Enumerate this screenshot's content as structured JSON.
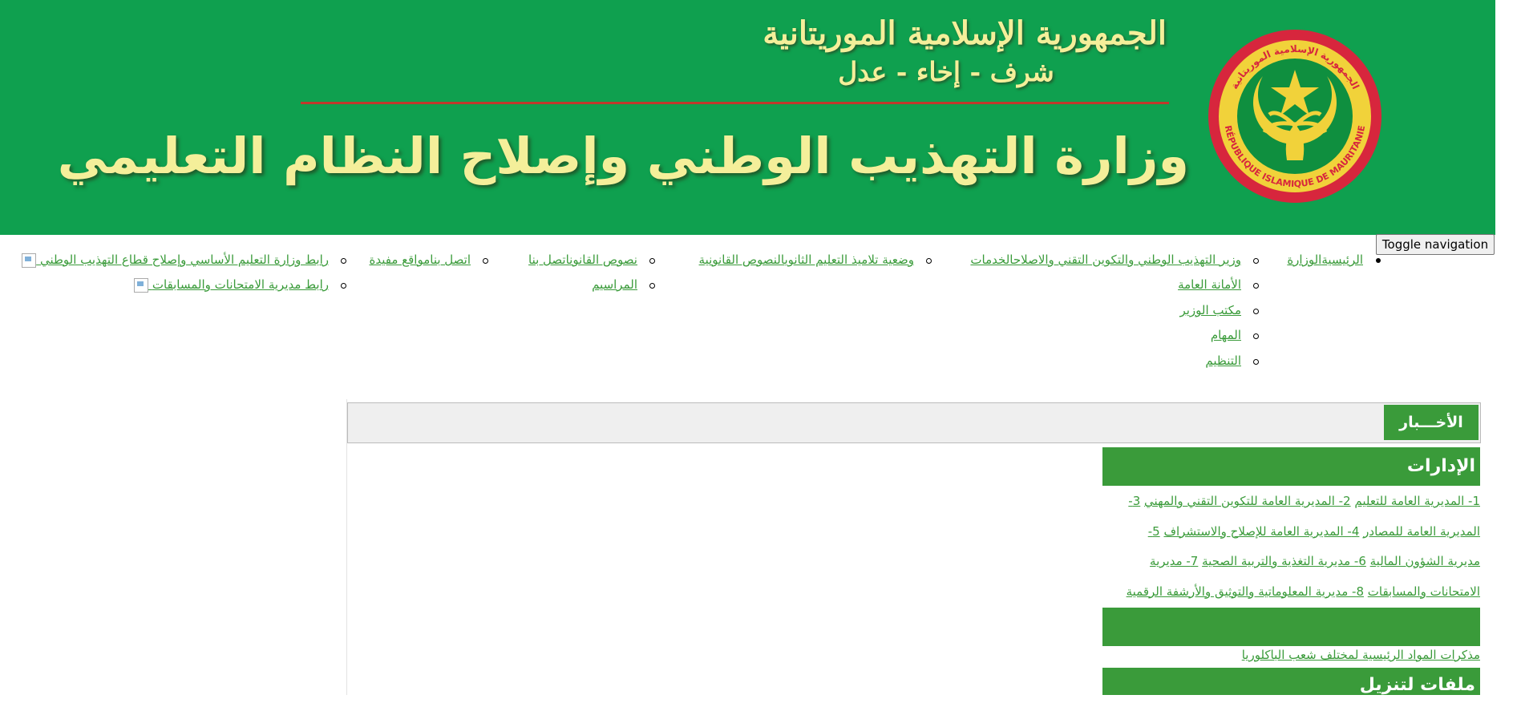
{
  "banner": {
    "republic": "الجمهورية الإسلامية الموريتانية",
    "motto": "شرف - إخاء - عدل",
    "ministry": "وزارة التهذيب الوطني وإصلاح النظام التعليمي",
    "seal_ring_text": "الجمهورية الإسلامية الموريتانية",
    "seal_ring_text_fr": "RÉPUBLIQUE ISLAMIQUE DE MAURITANIE",
    "colors": {
      "green": "#0fa04f",
      "yellow": "#f4ef9a",
      "red": "#c0392b"
    }
  },
  "toggle": {
    "label": "Toggle navigation"
  },
  "nav": {
    "home": "الرئيسية",
    "ministry": "الوزارة",
    "ministry_sub": [
      "وزير التهذيب الوطني والتكوين التقني والاصلاح",
      "الأمانة العامة",
      "مكتب الوزير",
      "المهام",
      "التنظيم"
    ],
    "services": "الخدمات",
    "secondary_status": "وضعية تلاميذ التعليم الثانوي",
    "legal": "النصوص القانونية",
    "legal_sub": [
      "نصوص القانون",
      "المراسيم"
    ],
    "contact": "اتصل بنا",
    "contact_sub": [
      "اتصل بنا"
    ],
    "useful": "مواقع مفيدة",
    "useful_sub": [
      "رابط وزارة التعليم الأساسي وإصلاح قطاع التهذيب الوطني",
      "رابط مديرية الامتحانات والمسابقات"
    ]
  },
  "news": {
    "title": "الأخـــبار"
  },
  "directorates": {
    "title": "الإدارات",
    "lines": [
      [
        "1- المديرية العامة للتعليم",
        "2- المديرية العامة للتكوين التقني والمهني",
        "3-"
      ],
      [
        "المديرية العامة للمصادر",
        "4- المديرية العامة للإصلاح والاستشراف",
        "5-"
      ],
      [
        "مديرية الشؤون المالية",
        "6- مديرية التغذية والتربية الصحية",
        "7- مديرية"
      ],
      [
        "الامتحانات والمسابقات",
        "8- مديرية المعلوماتية والتوثيق والأرشفة الرقمية"
      ]
    ]
  },
  "downloads_empty": {
    "link": "مذكرات المواد الرئيسية لمختلف شعب الباكلوريا"
  },
  "downloads": {
    "title": "ملفات لتنزيل"
  }
}
